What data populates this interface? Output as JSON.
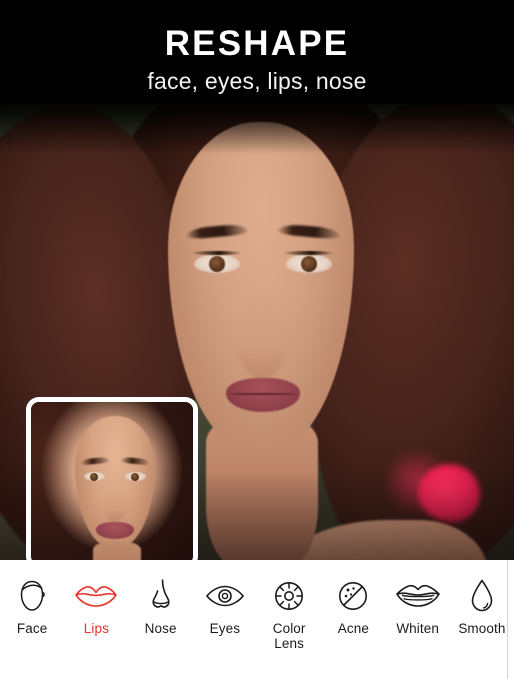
{
  "header": {
    "title": "RESHAPE",
    "subtitle": "face, eyes, lips, nose"
  },
  "photo": {
    "alt": "portrait-photo",
    "thumbnail_alt": "face-preview-thumbnail"
  },
  "controls": {
    "undo": {
      "name": "undo-arrow",
      "glyph": "←"
    },
    "redo": {
      "name": "redo-arrow",
      "glyph": "→"
    },
    "compare": {
      "name": "compare-before-after",
      "label": ""
    }
  },
  "toolbar": {
    "selected": "Lips",
    "accent_color": "#e8332a",
    "default_color": "#1b1b1b",
    "items": [
      {
        "label": "Face",
        "icon": "face-icon",
        "active": false
      },
      {
        "label": "Lips",
        "icon": "lips-icon",
        "active": true
      },
      {
        "label": "Nose",
        "icon": "nose-icon",
        "active": false
      },
      {
        "label": "Eyes",
        "icon": "eye-icon",
        "active": false
      },
      {
        "label": "Color\nLens",
        "icon": "color-lens-icon",
        "active": false
      },
      {
        "label": "Acne",
        "icon": "acne-icon",
        "active": false
      },
      {
        "label": "Whiten",
        "icon": "whiten-icon",
        "active": false
      },
      {
        "label": "Smooth",
        "icon": "smooth-drop-icon",
        "active": false
      }
    ]
  }
}
